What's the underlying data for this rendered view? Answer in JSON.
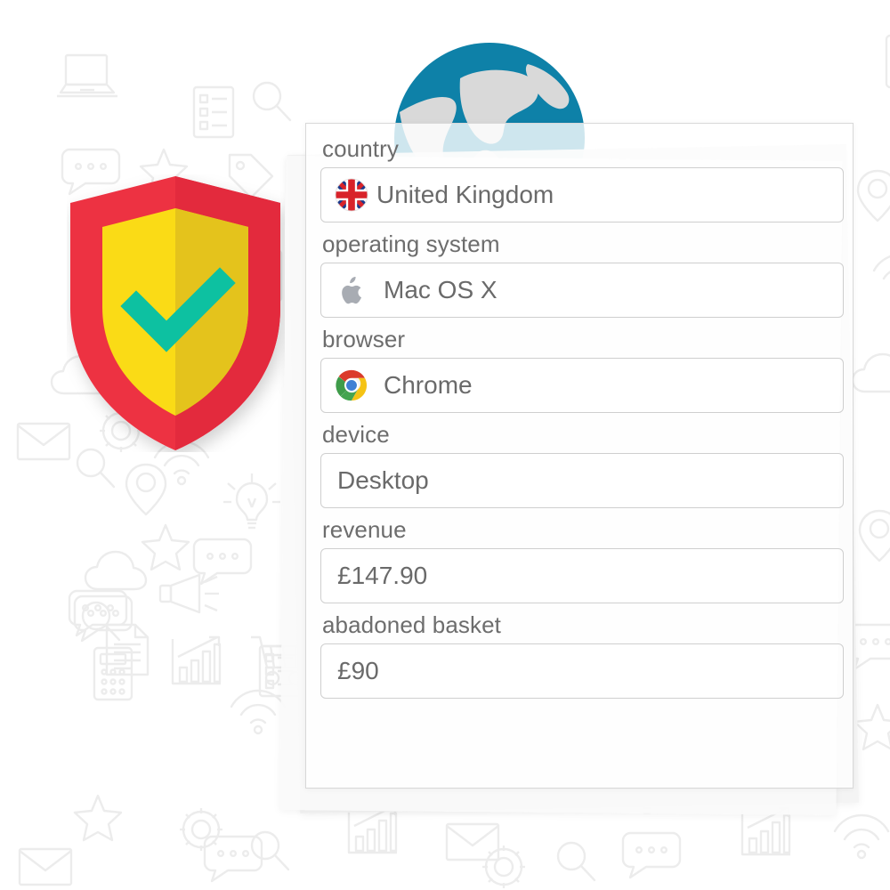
{
  "background": {
    "style": "doodle-icon-pattern",
    "color": "#efefef",
    "icons": [
      "laptop-icon",
      "magnifier-icon",
      "map-pin-icon",
      "star-icon",
      "cloud-icon",
      "document-icon",
      "speech-bubble-icon",
      "megaphone-icon",
      "shopping-cart-icon",
      "lightbulb-icon",
      "calculator-icon",
      "envelope-icon",
      "bar-chart-icon",
      "gear-icon",
      "wifi-icon",
      "checklist-icon",
      "play-icon",
      "lock-icon"
    ]
  },
  "decorations": {
    "shield": {
      "name": "security-shield-badge",
      "border_color": "#ED3142",
      "face_light": "#FADB12",
      "face_dark": "#E4C31C",
      "check_color": "#0FC1A1"
    },
    "globe": {
      "name": "globe-icon",
      "ocean_color": "#0E81A8",
      "land_color": "#D8D8D8"
    },
    "folder": {
      "name": "folder-icon",
      "front_color": "#FDE9D6",
      "back_color": "#FBF6D2"
    },
    "highlight_blob": {
      "name": "green-highlight-blob",
      "color": "#F0F6E9"
    }
  },
  "card": {
    "name": "details-card",
    "background": "#ffffff",
    "border_color": "#d8d8d8",
    "stacked_layers": 3
  },
  "form": {
    "fields": [
      {
        "id": "country",
        "label": "country",
        "value": "United Kingdom",
        "icon": "uk-flag-icon",
        "has_icon": true
      },
      {
        "id": "operating-system",
        "label": "operating system",
        "value": "Mac OS X",
        "icon": "apple-icon",
        "has_icon": true
      },
      {
        "id": "browser",
        "label": "browser",
        "value": "Chrome",
        "icon": "chrome-icon",
        "has_icon": true
      },
      {
        "id": "device",
        "label": "device",
        "value": "Desktop",
        "icon": "",
        "has_icon": false
      },
      {
        "id": "revenue",
        "label": "revenue",
        "value": "£147.90",
        "icon": "",
        "has_icon": false
      },
      {
        "id": "abadoned-basket",
        "label": "abadoned basket",
        "value": "£90",
        "icon": "",
        "has_icon": false
      }
    ]
  }
}
